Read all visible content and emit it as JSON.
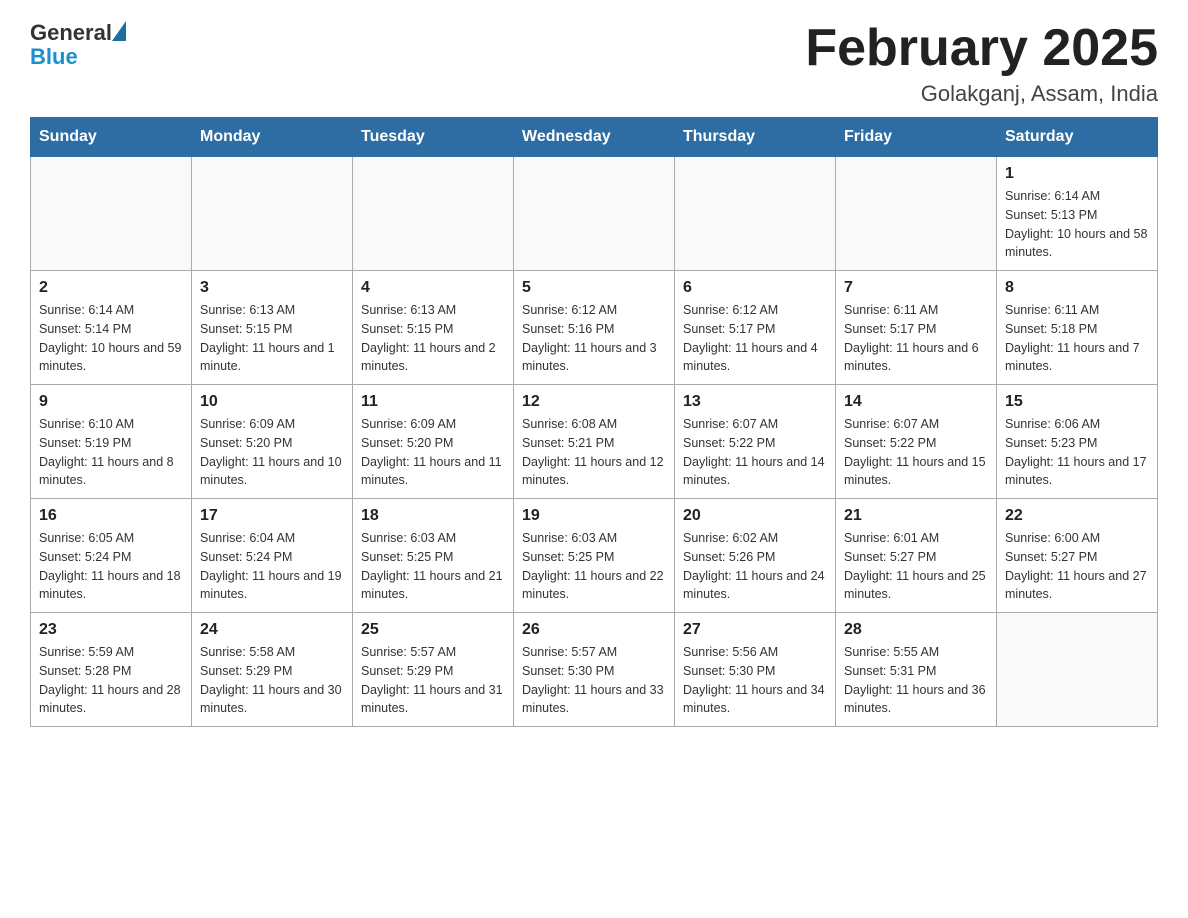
{
  "header": {
    "logo_general": "General",
    "logo_blue": "Blue",
    "month_title": "February 2025",
    "location": "Golakganj, Assam, India"
  },
  "days_of_week": [
    "Sunday",
    "Monday",
    "Tuesday",
    "Wednesday",
    "Thursday",
    "Friday",
    "Saturday"
  ],
  "weeks": [
    [
      {
        "day": "",
        "sunrise": "",
        "sunset": "",
        "daylight": ""
      },
      {
        "day": "",
        "sunrise": "",
        "sunset": "",
        "daylight": ""
      },
      {
        "day": "",
        "sunrise": "",
        "sunset": "",
        "daylight": ""
      },
      {
        "day": "",
        "sunrise": "",
        "sunset": "",
        "daylight": ""
      },
      {
        "day": "",
        "sunrise": "",
        "sunset": "",
        "daylight": ""
      },
      {
        "day": "",
        "sunrise": "",
        "sunset": "",
        "daylight": ""
      },
      {
        "day": "1",
        "sunrise": "Sunrise: 6:14 AM",
        "sunset": "Sunset: 5:13 PM",
        "daylight": "Daylight: 10 hours and 58 minutes."
      }
    ],
    [
      {
        "day": "2",
        "sunrise": "Sunrise: 6:14 AM",
        "sunset": "Sunset: 5:14 PM",
        "daylight": "Daylight: 10 hours and 59 minutes."
      },
      {
        "day": "3",
        "sunrise": "Sunrise: 6:13 AM",
        "sunset": "Sunset: 5:15 PM",
        "daylight": "Daylight: 11 hours and 1 minute."
      },
      {
        "day": "4",
        "sunrise": "Sunrise: 6:13 AM",
        "sunset": "Sunset: 5:15 PM",
        "daylight": "Daylight: 11 hours and 2 minutes."
      },
      {
        "day": "5",
        "sunrise": "Sunrise: 6:12 AM",
        "sunset": "Sunset: 5:16 PM",
        "daylight": "Daylight: 11 hours and 3 minutes."
      },
      {
        "day": "6",
        "sunrise": "Sunrise: 6:12 AM",
        "sunset": "Sunset: 5:17 PM",
        "daylight": "Daylight: 11 hours and 4 minutes."
      },
      {
        "day": "7",
        "sunrise": "Sunrise: 6:11 AM",
        "sunset": "Sunset: 5:17 PM",
        "daylight": "Daylight: 11 hours and 6 minutes."
      },
      {
        "day": "8",
        "sunrise": "Sunrise: 6:11 AM",
        "sunset": "Sunset: 5:18 PM",
        "daylight": "Daylight: 11 hours and 7 minutes."
      }
    ],
    [
      {
        "day": "9",
        "sunrise": "Sunrise: 6:10 AM",
        "sunset": "Sunset: 5:19 PM",
        "daylight": "Daylight: 11 hours and 8 minutes."
      },
      {
        "day": "10",
        "sunrise": "Sunrise: 6:09 AM",
        "sunset": "Sunset: 5:20 PM",
        "daylight": "Daylight: 11 hours and 10 minutes."
      },
      {
        "day": "11",
        "sunrise": "Sunrise: 6:09 AM",
        "sunset": "Sunset: 5:20 PM",
        "daylight": "Daylight: 11 hours and 11 minutes."
      },
      {
        "day": "12",
        "sunrise": "Sunrise: 6:08 AM",
        "sunset": "Sunset: 5:21 PM",
        "daylight": "Daylight: 11 hours and 12 minutes."
      },
      {
        "day": "13",
        "sunrise": "Sunrise: 6:07 AM",
        "sunset": "Sunset: 5:22 PM",
        "daylight": "Daylight: 11 hours and 14 minutes."
      },
      {
        "day": "14",
        "sunrise": "Sunrise: 6:07 AM",
        "sunset": "Sunset: 5:22 PM",
        "daylight": "Daylight: 11 hours and 15 minutes."
      },
      {
        "day": "15",
        "sunrise": "Sunrise: 6:06 AM",
        "sunset": "Sunset: 5:23 PM",
        "daylight": "Daylight: 11 hours and 17 minutes."
      }
    ],
    [
      {
        "day": "16",
        "sunrise": "Sunrise: 6:05 AM",
        "sunset": "Sunset: 5:24 PM",
        "daylight": "Daylight: 11 hours and 18 minutes."
      },
      {
        "day": "17",
        "sunrise": "Sunrise: 6:04 AM",
        "sunset": "Sunset: 5:24 PM",
        "daylight": "Daylight: 11 hours and 19 minutes."
      },
      {
        "day": "18",
        "sunrise": "Sunrise: 6:03 AM",
        "sunset": "Sunset: 5:25 PM",
        "daylight": "Daylight: 11 hours and 21 minutes."
      },
      {
        "day": "19",
        "sunrise": "Sunrise: 6:03 AM",
        "sunset": "Sunset: 5:25 PM",
        "daylight": "Daylight: 11 hours and 22 minutes."
      },
      {
        "day": "20",
        "sunrise": "Sunrise: 6:02 AM",
        "sunset": "Sunset: 5:26 PM",
        "daylight": "Daylight: 11 hours and 24 minutes."
      },
      {
        "day": "21",
        "sunrise": "Sunrise: 6:01 AM",
        "sunset": "Sunset: 5:27 PM",
        "daylight": "Daylight: 11 hours and 25 minutes."
      },
      {
        "day": "22",
        "sunrise": "Sunrise: 6:00 AM",
        "sunset": "Sunset: 5:27 PM",
        "daylight": "Daylight: 11 hours and 27 minutes."
      }
    ],
    [
      {
        "day": "23",
        "sunrise": "Sunrise: 5:59 AM",
        "sunset": "Sunset: 5:28 PM",
        "daylight": "Daylight: 11 hours and 28 minutes."
      },
      {
        "day": "24",
        "sunrise": "Sunrise: 5:58 AM",
        "sunset": "Sunset: 5:29 PM",
        "daylight": "Daylight: 11 hours and 30 minutes."
      },
      {
        "day": "25",
        "sunrise": "Sunrise: 5:57 AM",
        "sunset": "Sunset: 5:29 PM",
        "daylight": "Daylight: 11 hours and 31 minutes."
      },
      {
        "day": "26",
        "sunrise": "Sunrise: 5:57 AM",
        "sunset": "Sunset: 5:30 PM",
        "daylight": "Daylight: 11 hours and 33 minutes."
      },
      {
        "day": "27",
        "sunrise": "Sunrise: 5:56 AM",
        "sunset": "Sunset: 5:30 PM",
        "daylight": "Daylight: 11 hours and 34 minutes."
      },
      {
        "day": "28",
        "sunrise": "Sunrise: 5:55 AM",
        "sunset": "Sunset: 5:31 PM",
        "daylight": "Daylight: 11 hours and 36 minutes."
      },
      {
        "day": "",
        "sunrise": "",
        "sunset": "",
        "daylight": ""
      }
    ]
  ]
}
